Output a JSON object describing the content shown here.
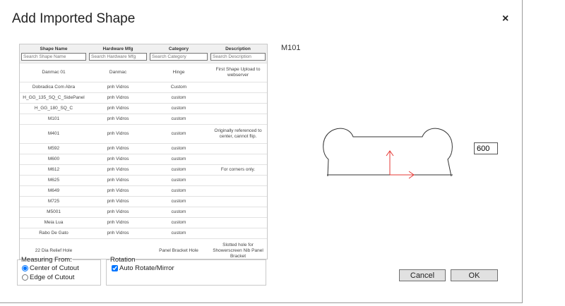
{
  "dialog": {
    "title": "Add Imported Shape",
    "close_glyph": "×"
  },
  "table": {
    "headers": [
      "Shape Name",
      "Hardware Mfg",
      "Category",
      "Description"
    ],
    "filters": [
      "Search Shape Name",
      "Search Hardware Mfg",
      "Search Category",
      "Search Description"
    ],
    "rows": [
      [
        "Danmac 01",
        "Danmac",
        "Hinge",
        "First Shape Upload to webserver"
      ],
      [
        "Dobradica Com Abra",
        "pnh Vidros",
        "Custom",
        ""
      ],
      [
        "H_GG_135_SQ_C_SidePanel",
        "pnh Vidros",
        "custom",
        ""
      ],
      [
        "H_GG_180_SQ_C",
        "pnh Vidros",
        "custom",
        ""
      ],
      [
        "M101",
        "pnh Vidros",
        "custom",
        ""
      ],
      [
        "M401",
        "pnh Vidros",
        "custom",
        "Originally referenced to center, cannot flip."
      ],
      [
        "M592",
        "pnh Vidros",
        "custom",
        ""
      ],
      [
        "M600",
        "pnh Vidros",
        "custom",
        ""
      ],
      [
        "M612",
        "pnh Vidros",
        "custom",
        "For corners only."
      ],
      [
        "M625",
        "pnh Vidros",
        "custom",
        ""
      ],
      [
        "M649",
        "pnh Vidros",
        "custom",
        ""
      ],
      [
        "M725",
        "pnh Vidros",
        "custom",
        ""
      ],
      [
        "M5001",
        "pnh Vidros",
        "custom",
        ""
      ],
      [
        "Meia Lua",
        "pnh Vidros",
        "custom",
        ""
      ],
      [
        "Rabo De Gato",
        "pnh Vidros",
        "custom",
        ""
      ],
      [
        "22 Dia Relief Hole",
        "",
        "Panel Bracket Hole",
        "Slotted hole for Showerscreen Nib Panel Bracket"
      ]
    ]
  },
  "preview": {
    "shape_name": "M101",
    "width_value": "600",
    "axis_color": "#e53935",
    "outline_color": "#333333"
  },
  "measuring": {
    "legend": "Measuring From:",
    "options": [
      {
        "label": "Center of Cutout",
        "checked": true
      },
      {
        "label": "Edge of Cutout",
        "checked": false
      }
    ]
  },
  "rotation": {
    "legend": "Rotation",
    "auto_label": "Auto Rotate/Mirror",
    "auto_checked": true
  },
  "buttons": {
    "cancel": "Cancel",
    "ok": "OK"
  }
}
